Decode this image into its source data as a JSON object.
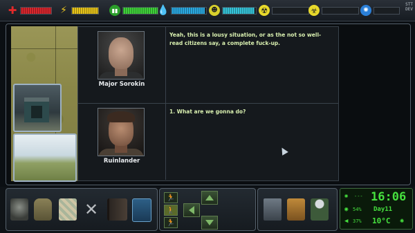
{
  "status_bars": [
    {
      "name": "health",
      "icon": "health-cross-icon",
      "color": "#d8262d",
      "level": 1.0
    },
    {
      "name": "energy",
      "icon": "lightning-icon",
      "color": "#e5c21a",
      "level": 1.0
    },
    {
      "name": "food",
      "icon": "food-icon",
      "color": "#3fd03a",
      "level": 1.0
    },
    {
      "name": "water",
      "icon": "water-drop-icon",
      "color": "#2aa8e0",
      "level": 0.95
    },
    {
      "name": "oxygen",
      "icon": "gasmask-icon",
      "color": "#35c3d8",
      "level": 0.95
    },
    {
      "name": "radiation",
      "icon": "radiation-icon",
      "color": "#e8d92b",
      "level": 0.0
    },
    {
      "name": "toxicity",
      "icon": "biohazard-icon",
      "color": "#e8d92b",
      "level": 0.0
    },
    {
      "name": "psyche",
      "icon": "brain-icon",
      "color": "#2a7fd8",
      "level": 0.0
    }
  ],
  "corner_label": {
    "line1": "STT",
    "line2": "DEV"
  },
  "dialogue": {
    "entries": [
      {
        "speaker": "Major Sorokin",
        "text": "Yeah, this is a lousy situation, or as the not so well-read citizens say, a complete fuck-up."
      },
      {
        "speaker": "Ruinlander",
        "text": "1. What are we gonna do?"
      }
    ]
  },
  "toolbar": {
    "items": [
      {
        "name": "gasmask",
        "icon": "gasmask-icon"
      },
      {
        "name": "backpack",
        "icon": "backpack-icon"
      },
      {
        "name": "map",
        "icon": "map-icon"
      },
      {
        "name": "tools",
        "icon": "wrench-icon"
      },
      {
        "name": "journal",
        "icon": "book-icon"
      },
      {
        "name": "pda",
        "icon": "pda-icon"
      }
    ]
  },
  "movement": {
    "modes": [
      {
        "name": "run",
        "icon": "run-icon",
        "active": false
      },
      {
        "name": "walk",
        "icon": "walk-icon",
        "active": true
      },
      {
        "name": "sneak",
        "icon": "sneak-icon",
        "active": false
      }
    ]
  },
  "actions": {
    "items": [
      {
        "name": "craft",
        "icon": "craft-icon"
      },
      {
        "name": "loot",
        "icon": "loot-box-icon"
      },
      {
        "name": "character",
        "icon": "character-icon"
      }
    ]
  },
  "hud": {
    "time": "16:06",
    "day": "Day11",
    "temperature": "10°C",
    "top_left": "---",
    "visibility": "54%",
    "noise": "37%"
  }
}
